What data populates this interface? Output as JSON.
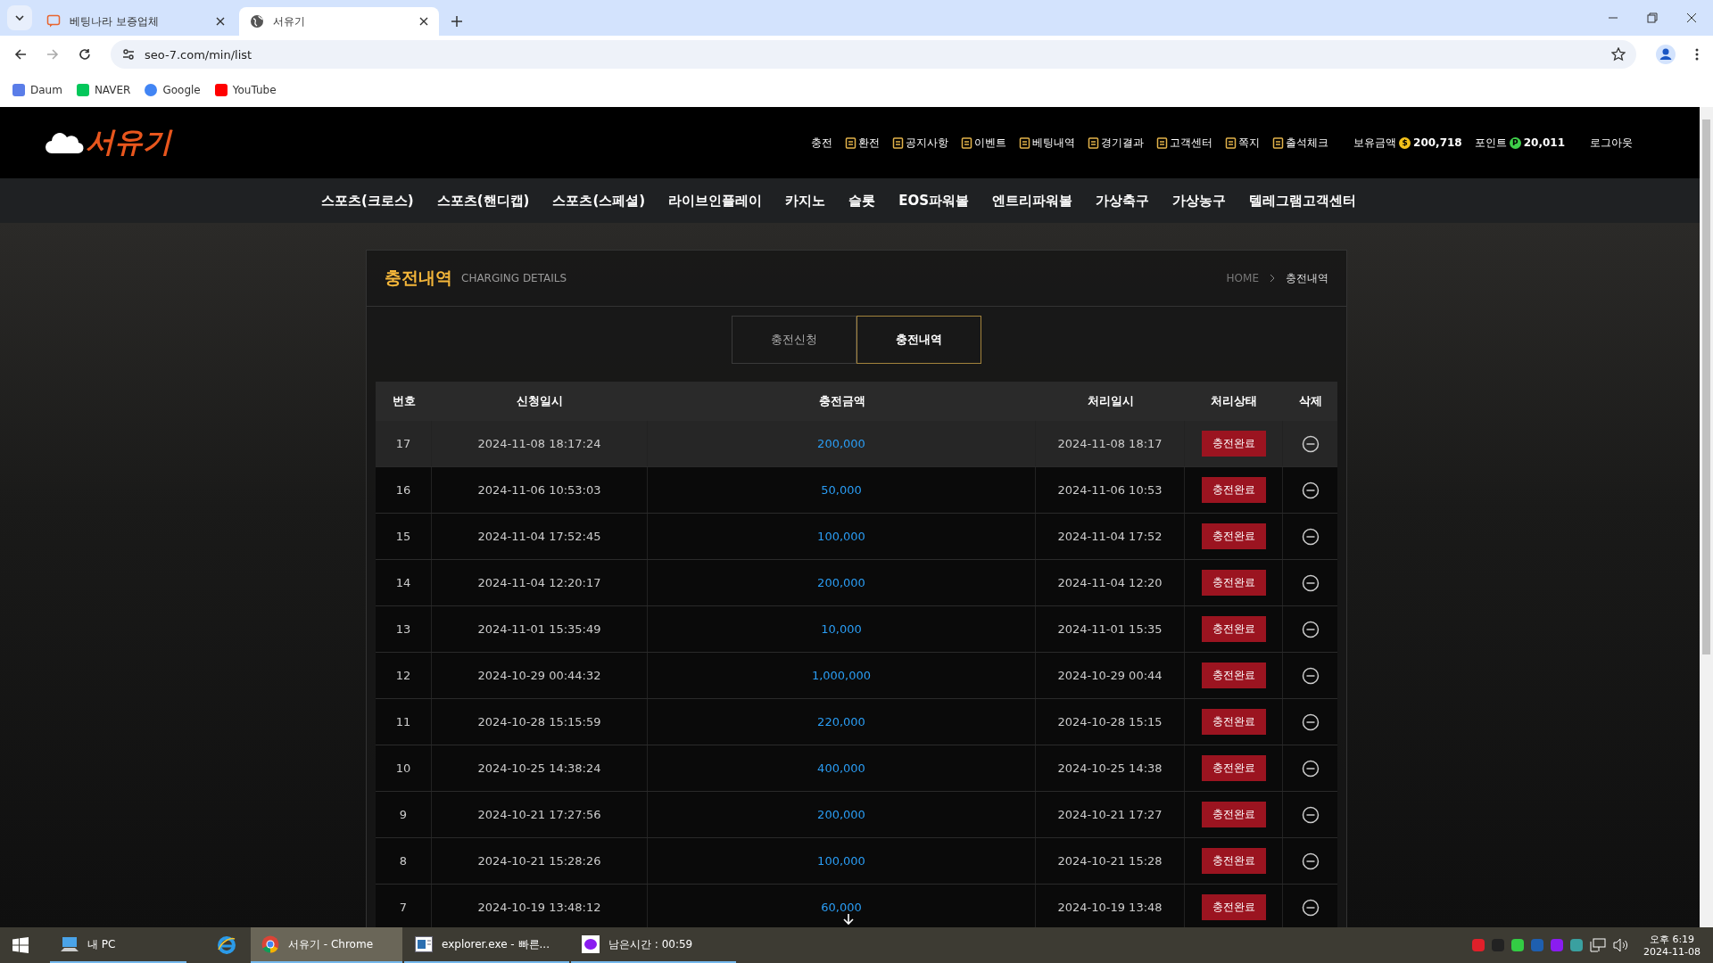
{
  "browser": {
    "tabs": [
      {
        "title": "베팅나라 보증업체",
        "selected": false
      },
      {
        "title": "서유기",
        "selected": true
      }
    ],
    "address": "seo-7.com/min/list",
    "bookmarks": [
      "Daum",
      "NAVER",
      "Google",
      "YouTube"
    ]
  },
  "site": {
    "logo": "서유기",
    "top_menu": [
      {
        "label": "충전",
        "icon": false
      },
      {
        "label": "환전",
        "icon": true
      },
      {
        "label": "공지사항",
        "icon": true
      },
      {
        "label": "이벤트",
        "icon": true
      },
      {
        "label": "베팅내역",
        "icon": true
      },
      {
        "label": "경기결과",
        "icon": true
      },
      {
        "label": "고객센터",
        "icon": true
      },
      {
        "label": "쪽지",
        "icon": true
      },
      {
        "label": "출석체크",
        "icon": true
      }
    ],
    "balance": {
      "label": "보유금액",
      "coin": "$",
      "value": "200,718"
    },
    "points": {
      "label": "포인트",
      "coin": "P",
      "value": "20,011"
    },
    "logout": "로그아웃",
    "nav": [
      "스포츠(크로스)",
      "스포츠(핸디캡)",
      "스포츠(스페셜)",
      "라이브인플레이",
      "카지노",
      "슬롯",
      "EOS파워볼",
      "엔트리파워볼",
      "가상축구",
      "가상농구",
      "텔레그램고객센터"
    ]
  },
  "page": {
    "title": "충전내역",
    "subtitle": "CHARGING DETAILS",
    "breadcrumb": [
      "HOME",
      "충전내역"
    ],
    "tabs": [
      {
        "label": "충전신청",
        "selected": false
      },
      {
        "label": "충전내역",
        "selected": true
      }
    ],
    "table": {
      "columns": [
        "번호",
        "신청일시",
        "충전금액",
        "처리일시",
        "처리상태",
        "삭제"
      ],
      "rows": [
        {
          "no": "17",
          "requested": "2024-11-08 18:17:24",
          "amount": "200,000",
          "processed": "2024-11-08 18:17",
          "status": "충전완료",
          "selected": true
        },
        {
          "no": "16",
          "requested": "2024-11-06 10:53:03",
          "amount": "50,000",
          "processed": "2024-11-06 10:53",
          "status": "충전완료",
          "selected": false
        },
        {
          "no": "15",
          "requested": "2024-11-04 17:52:45",
          "amount": "100,000",
          "processed": "2024-11-04 17:52",
          "status": "충전완료",
          "selected": false
        },
        {
          "no": "14",
          "requested": "2024-11-04 12:20:17",
          "amount": "200,000",
          "processed": "2024-11-04 12:20",
          "status": "충전완료",
          "selected": false
        },
        {
          "no": "13",
          "requested": "2024-11-01 15:35:49",
          "amount": "10,000",
          "processed": "2024-11-01 15:35",
          "status": "충전완료",
          "selected": false
        },
        {
          "no": "12",
          "requested": "2024-10-29 00:44:32",
          "amount": "1,000,000",
          "processed": "2024-10-29 00:44",
          "status": "충전완료",
          "selected": false
        },
        {
          "no": "11",
          "requested": "2024-10-28 15:15:59",
          "amount": "220,000",
          "processed": "2024-10-28 15:15",
          "status": "충전완료",
          "selected": false
        },
        {
          "no": "10",
          "requested": "2024-10-25 14:38:24",
          "amount": "400,000",
          "processed": "2024-10-25 14:38",
          "status": "충전완료",
          "selected": false
        },
        {
          "no": "9",
          "requested": "2024-10-21 17:27:56",
          "amount": "200,000",
          "processed": "2024-10-21 17:27",
          "status": "충전완료",
          "selected": false
        },
        {
          "no": "8",
          "requested": "2024-10-21 15:28:26",
          "amount": "100,000",
          "processed": "2024-10-21 15:28",
          "status": "충전완료",
          "selected": false
        },
        {
          "no": "7",
          "requested": "2024-10-19 13:48:12",
          "amount": "60,000",
          "processed": "2024-10-19 13:48",
          "status": "충전완료",
          "selected": false
        }
      ]
    }
  },
  "taskbar": {
    "items": [
      {
        "label": "내 PC",
        "kind": "pc",
        "selected": false
      },
      {
        "kind": "ie",
        "selected": false
      },
      {
        "label": "서유기 - Chrome",
        "kind": "chrome",
        "selected": true
      },
      {
        "label": "explorer.exe - 빠른...",
        "kind": "explorer",
        "selected": false
      },
      {
        "label": "남은시간 : 00:59",
        "kind": "timer",
        "selected": false
      }
    ],
    "time": "오후 6:19",
    "date": "2024-11-08"
  }
}
